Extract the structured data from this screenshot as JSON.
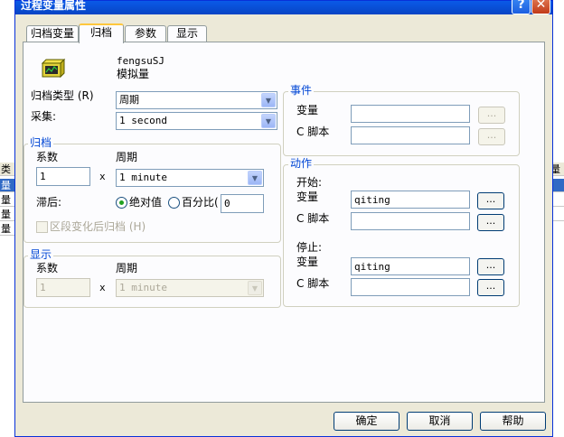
{
  "window": {
    "title": "过程变量属性",
    "help_glyph": "?",
    "close_glyph": "✕"
  },
  "tabs": [
    {
      "label": "归档变量",
      "active": false
    },
    {
      "label": "归档",
      "active": true
    },
    {
      "label": "参数",
      "active": false
    },
    {
      "label": "显示",
      "active": false
    }
  ],
  "tag": {
    "name": "fengsuSJ",
    "type": "模拟量",
    "icon": "analog-tag-icon"
  },
  "archive_type": {
    "label": "归档类型 (R)",
    "value": "周期"
  },
  "acquisition": {
    "label": "采集:",
    "value": "1 second"
  },
  "archive_group": {
    "title": "归档",
    "factor_label": "系数",
    "cycle_label": "周期",
    "factor_value": "1",
    "times": "x",
    "cycle_value": "1 minute",
    "hysteresis_label": "滞后:",
    "absolute_label": "绝对值",
    "percent_label": "百分比(",
    "hysteresis_value": "0",
    "segment_change_label": "区段变化后归档 (H)"
  },
  "display_group": {
    "title": "显示",
    "factor_label": "系数",
    "cycle_label": "周期",
    "factor_value": "1",
    "times": "x",
    "cycle_value": "1 minute"
  },
  "events_group": {
    "title": "事件",
    "variable_label": "变量",
    "script_label": "C 脚本",
    "browse": "..."
  },
  "actions_group": {
    "title": "动作",
    "start_label": "开始:",
    "stop_label": "停止:",
    "variable_label": "变量",
    "script_label": "C 脚本",
    "start_variable": "qiting",
    "stop_variable": "qiting",
    "browse": "..."
  },
  "buttons": {
    "ok": "确定",
    "cancel": "取消",
    "help": "帮助"
  },
  "background_left": [
    "类",
    "量",
    "量",
    "量",
    "量"
  ],
  "background_right": [
    "量"
  ],
  "colors": {
    "title_bar": "#0a5ae8",
    "group_title": "#0046d5",
    "dialog_bg": "#ece9d8",
    "selection": "#316ac5"
  }
}
